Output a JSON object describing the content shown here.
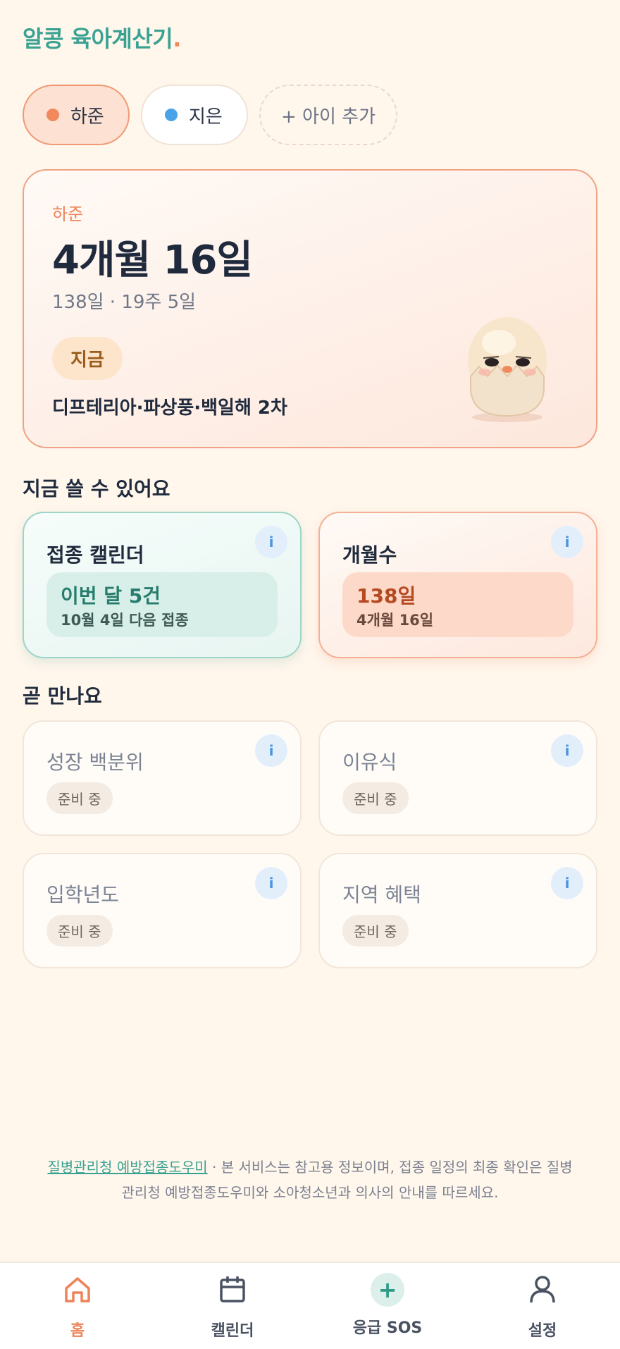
{
  "app": {
    "title": "알콩 육아계산기",
    "title_dot": "."
  },
  "children": {
    "items": [
      {
        "name": "하준",
        "color": "#f08a5d"
      },
      {
        "name": "지은",
        "color": "#4aa3e8"
      }
    ],
    "add_label": "+ 아이 추가"
  },
  "hero": {
    "child_name": "하준",
    "age": "4개월 16일",
    "days": "138일 · 19주 5일",
    "badge": "지금",
    "vaccine": "디프테리아·파상풍·백일해 2차",
    "mascot": "egg-chick-icon"
  },
  "available": {
    "title": "지금 쓸 수 있어요",
    "cards": [
      {
        "title": "접종 캘린더",
        "line1": "이번 달 5건",
        "line2": "10월 4일 다음 접종",
        "info": "i"
      },
      {
        "title": "개월수",
        "line1": "138일",
        "line2": "4개월 16일",
        "info": "i"
      }
    ]
  },
  "soon": {
    "title": "곧 만나요",
    "cards": [
      {
        "title": "성장 백분위",
        "tag": "준비 중",
        "info": "i"
      },
      {
        "title": "이유식",
        "tag": "준비 중",
        "info": "i"
      },
      {
        "title": "입학년도",
        "tag": "준비 중",
        "info": "i"
      },
      {
        "title": "지역 혜택",
        "tag": "준비 중",
        "info": "i"
      }
    ]
  },
  "footer": {
    "link": "질병관리청 예방접종도우미",
    "text": " · 본 서비스는 참고용 정보이며, 접종 일정의 최종 확인은 질병관리청 예방접종도우미와 소아청소년과 의사의 안내를 따르세요."
  },
  "tabs": [
    {
      "label": "홈",
      "icon": "home-icon"
    },
    {
      "label": "캘린더",
      "icon": "calendar-icon"
    },
    {
      "label": "응급 SOS",
      "icon": "plus-icon",
      "symbol": "+"
    },
    {
      "label": "설정",
      "icon": "person-icon"
    }
  ],
  "colors": {
    "accent": "#3aa292",
    "active": "#ee8258"
  }
}
